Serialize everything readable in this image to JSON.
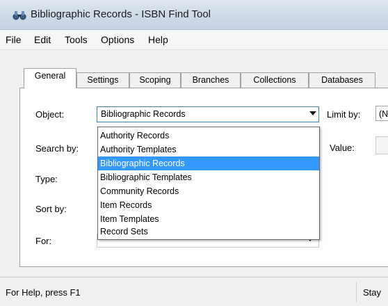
{
  "window": {
    "title": "Bibliographic Records - ISBN Find Tool",
    "icon": "binoculars-icon"
  },
  "menu": [
    "File",
    "Edit",
    "Tools",
    "Options",
    "Help"
  ],
  "tabs": [
    "General",
    "Settings",
    "Scoping",
    "Branches",
    "Collections",
    "Databases"
  ],
  "active_tab": "General",
  "form": {
    "object_label": "Object:",
    "object_value": "Bibliographic Records",
    "search_by_label": "Search by:",
    "type_label": "Type:",
    "sort_by_label": "Sort by:",
    "for_label": "For:",
    "limit_by_label": "Limit by:",
    "limit_by_value": "(N",
    "value_label": "Value:"
  },
  "dropdown": {
    "options": [
      "Authority Records",
      "Authority Templates",
      "Bibliographic Records",
      "Bibliographic Templates",
      "Community Records",
      "Item Records",
      "Item Templates",
      "Record Sets"
    ],
    "selected": "Bibliographic Records"
  },
  "status": {
    "left": "For Help, press F1",
    "right": "Stay"
  },
  "colors": {
    "selection": "#3399ff",
    "titlebar": "#cdd9e8"
  }
}
